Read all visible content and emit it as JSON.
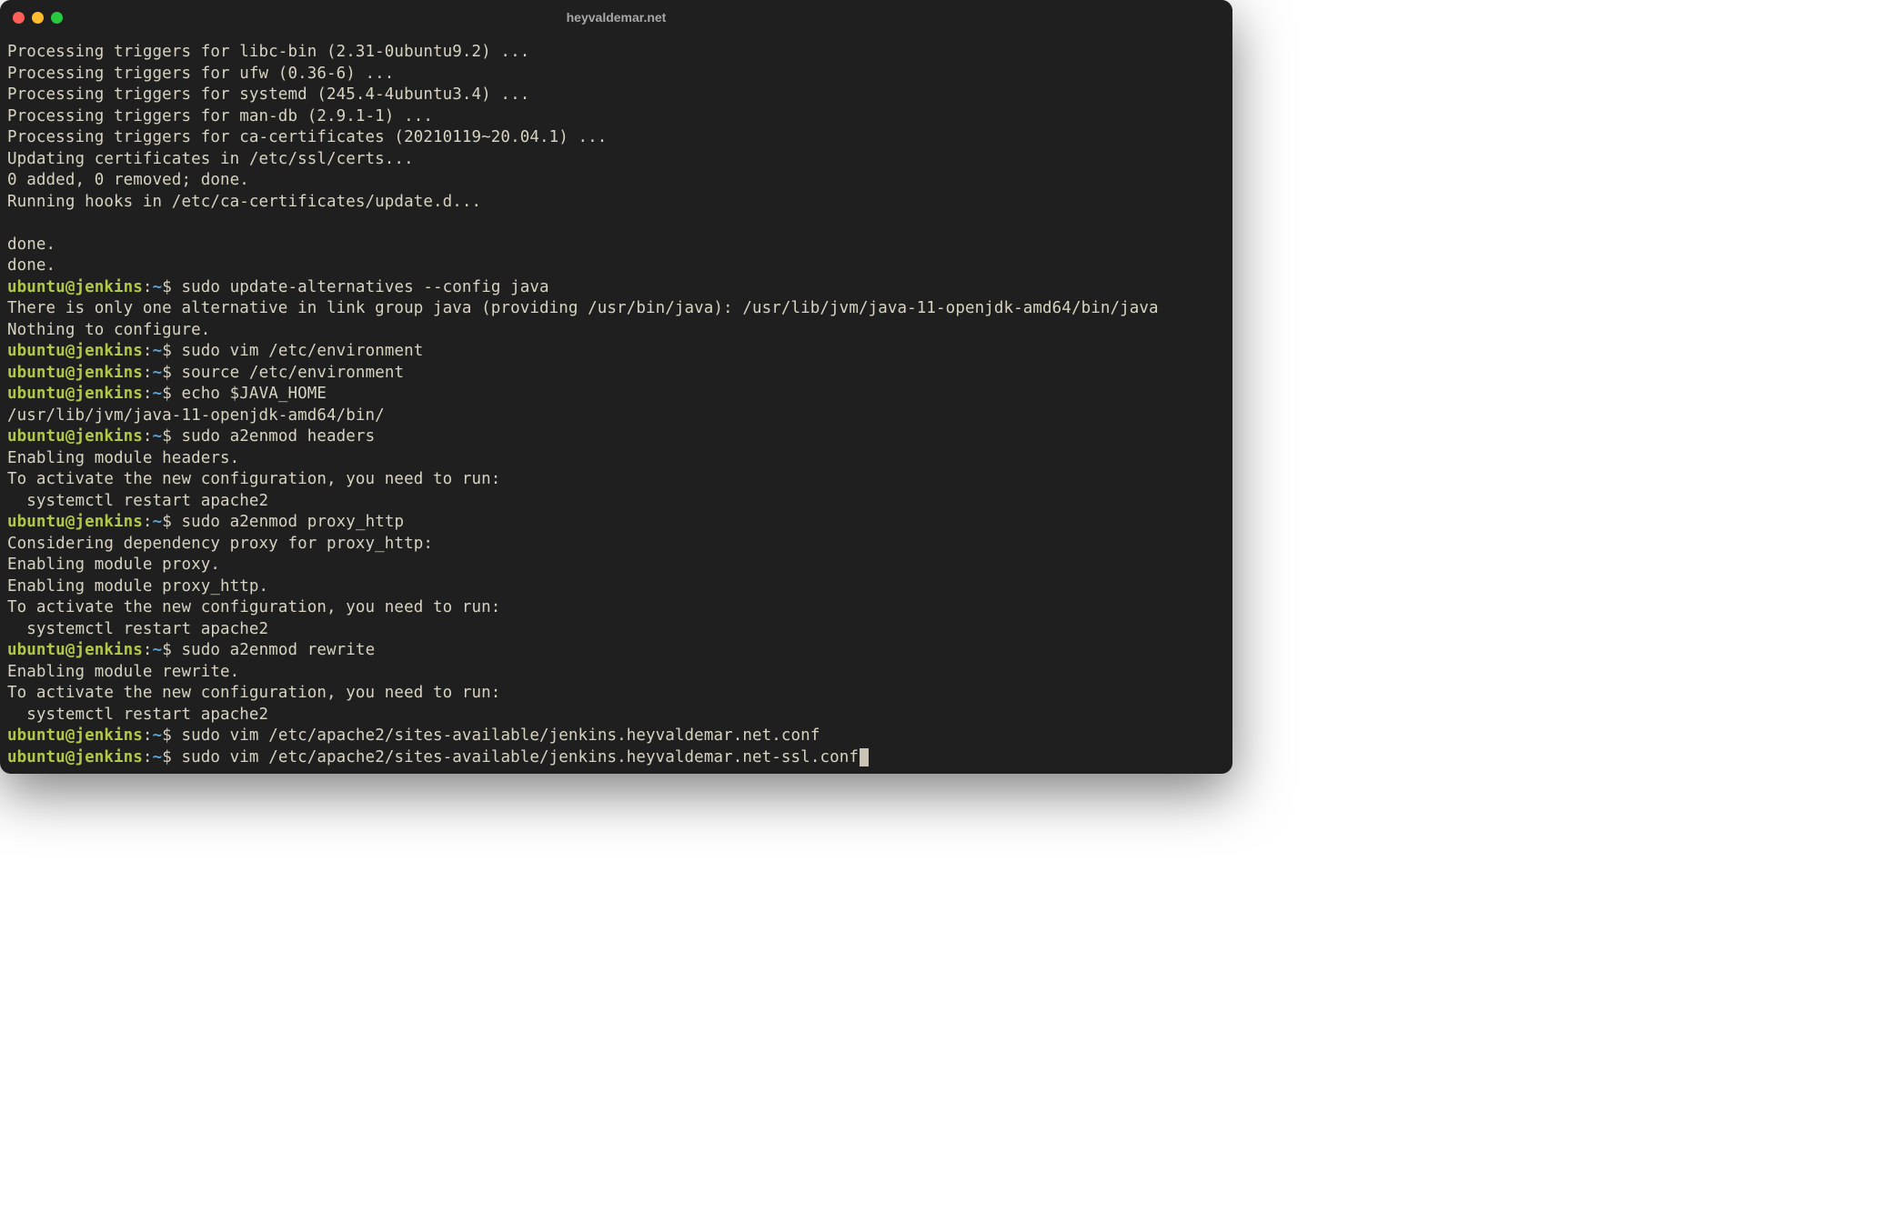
{
  "window": {
    "title": "heyvaldemar.net"
  },
  "colors": {
    "bg": "#1f1f1f",
    "text": "#d8d3c1",
    "prompt_user_host": "#b0c84a",
    "prompt_path": "#5aa1d1",
    "traffic_red": "#ff5f57",
    "traffic_yellow": "#febc2e",
    "traffic_green": "#28c840"
  },
  "prompt": {
    "user": "ubuntu",
    "host": "jenkins",
    "path": "~",
    "symbol": "$"
  },
  "lines": [
    {
      "type": "out",
      "text": "Processing triggers for libc-bin (2.31-0ubuntu9.2) ..."
    },
    {
      "type": "out",
      "text": "Processing triggers for ufw (0.36-6) ..."
    },
    {
      "type": "out",
      "text": "Processing triggers for systemd (245.4-4ubuntu3.4) ..."
    },
    {
      "type": "out",
      "text": "Processing triggers for man-db (2.9.1-1) ..."
    },
    {
      "type": "out",
      "text": "Processing triggers for ca-certificates (20210119~20.04.1) ..."
    },
    {
      "type": "out",
      "text": "Updating certificates in /etc/ssl/certs..."
    },
    {
      "type": "out",
      "text": "0 added, 0 removed; done."
    },
    {
      "type": "out",
      "text": "Running hooks in /etc/ca-certificates/update.d..."
    },
    {
      "type": "out",
      "text": ""
    },
    {
      "type": "out",
      "text": "done."
    },
    {
      "type": "out",
      "text": "done."
    },
    {
      "type": "cmd",
      "text": "sudo update-alternatives --config java"
    },
    {
      "type": "out",
      "text": "There is only one alternative in link group java (providing /usr/bin/java): /usr/lib/jvm/java-11-openjdk-amd64/bin/java"
    },
    {
      "type": "out",
      "text": "Nothing to configure."
    },
    {
      "type": "cmd",
      "text": "sudo vim /etc/environment"
    },
    {
      "type": "cmd",
      "text": "source /etc/environment"
    },
    {
      "type": "cmd",
      "text": "echo $JAVA_HOME"
    },
    {
      "type": "out",
      "text": "/usr/lib/jvm/java-11-openjdk-amd64/bin/"
    },
    {
      "type": "cmd",
      "text": "sudo a2enmod headers"
    },
    {
      "type": "out",
      "text": "Enabling module headers."
    },
    {
      "type": "out",
      "text": "To activate the new configuration, you need to run:"
    },
    {
      "type": "out",
      "text": "  systemctl restart apache2"
    },
    {
      "type": "cmd",
      "text": "sudo a2enmod proxy_http"
    },
    {
      "type": "out",
      "text": "Considering dependency proxy for proxy_http:"
    },
    {
      "type": "out",
      "text": "Enabling module proxy."
    },
    {
      "type": "out",
      "text": "Enabling module proxy_http."
    },
    {
      "type": "out",
      "text": "To activate the new configuration, you need to run:"
    },
    {
      "type": "out",
      "text": "  systemctl restart apache2"
    },
    {
      "type": "cmd",
      "text": "sudo a2enmod rewrite"
    },
    {
      "type": "out",
      "text": "Enabling module rewrite."
    },
    {
      "type": "out",
      "text": "To activate the new configuration, you need to run:"
    },
    {
      "type": "out",
      "text": "  systemctl restart apache2"
    },
    {
      "type": "cmd",
      "text": "sudo vim /etc/apache2/sites-available/jenkins.heyvaldemar.net.conf"
    },
    {
      "type": "cmd",
      "text": "sudo vim /etc/apache2/sites-available/jenkins.heyvaldemar.net-ssl.conf",
      "cursor": true
    }
  ]
}
